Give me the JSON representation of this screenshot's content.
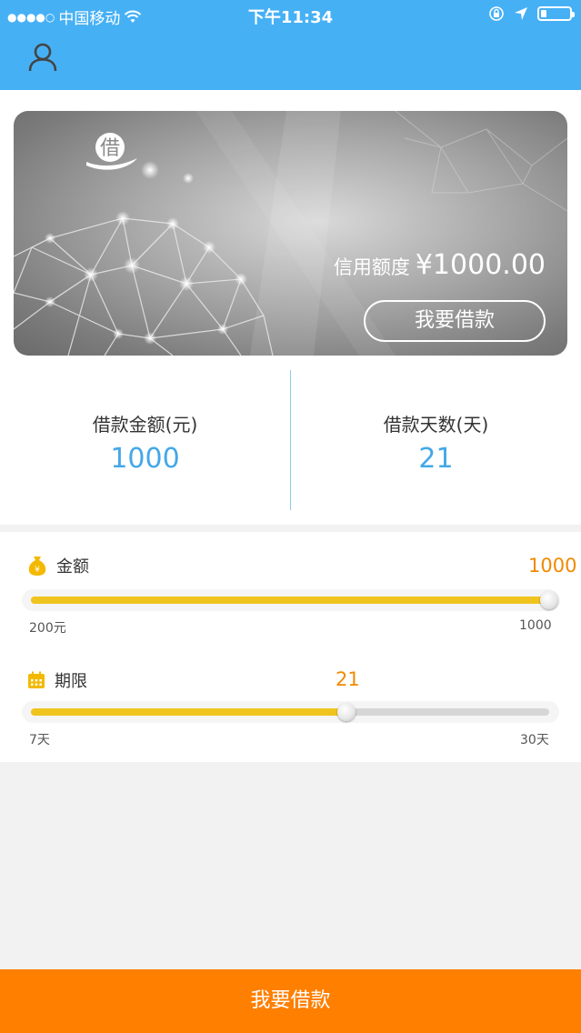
{
  "status_bar": {
    "signal": "●●●●○",
    "carrier": "中国移动",
    "time": "下午11:34"
  },
  "header": {
    "icons": [
      "user-icon"
    ],
    "color": "#46b0f5"
  },
  "card": {
    "logo_char": "借",
    "credit_label": "信用额度",
    "credit_amount": "¥1000.00",
    "button_label": "我要借款"
  },
  "summary": {
    "amount_label": "借款金额(元)",
    "amount_value": "1000",
    "days_label": "借款天数(天)",
    "days_value": "21"
  },
  "sliders": {
    "amount": {
      "title": "金额",
      "icon": "money-bag-icon",
      "value": "1000",
      "min_label": "200元",
      "max_label": "1000",
      "min": 200,
      "max": 1000,
      "current": 1000
    },
    "term": {
      "title": "期限",
      "icon": "calendar-icon",
      "value": "21",
      "min_label": "7天",
      "max_label": "30天",
      "min": 7,
      "max": 30,
      "current": 21
    }
  },
  "bottom": {
    "button_label": "我要借款",
    "color": "#ff7f00"
  }
}
